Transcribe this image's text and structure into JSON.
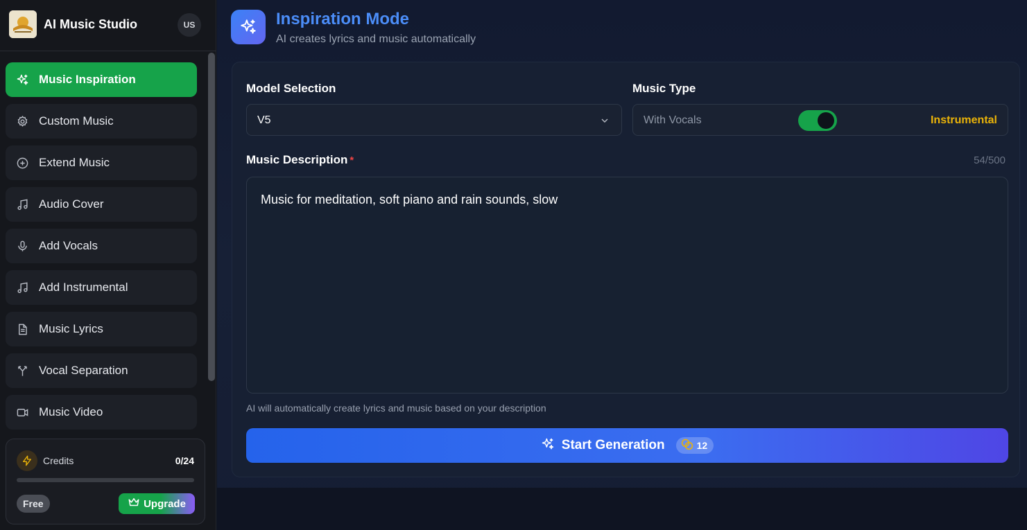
{
  "app": {
    "title": "AI Music Studio",
    "lang": "US"
  },
  "sidebar": {
    "items": [
      {
        "label": "Music Inspiration",
        "icon": "sparkles-icon",
        "active": true
      },
      {
        "label": "Custom Music",
        "icon": "gear-icon",
        "active": false
      },
      {
        "label": "Extend Music",
        "icon": "plus-circle-icon",
        "active": false
      },
      {
        "label": "Audio Cover",
        "icon": "music-note-icon",
        "active": false
      },
      {
        "label": "Add Vocals",
        "icon": "microphone-icon",
        "active": false
      },
      {
        "label": "Add Instrumental",
        "icon": "music-note-icon",
        "active": false
      },
      {
        "label": "Music Lyrics",
        "icon": "document-icon",
        "active": false
      },
      {
        "label": "Vocal Separation",
        "icon": "split-icon",
        "active": false
      },
      {
        "label": "Music Video",
        "icon": "video-icon",
        "active": false
      }
    ]
  },
  "credits": {
    "label": "Credits",
    "count": "0/24",
    "progress": 0,
    "plan": "Free",
    "upgrade_label": "Upgrade"
  },
  "main": {
    "title": "Inspiration Mode",
    "subtitle": "AI creates lyrics and music automatically",
    "model": {
      "label": "Model Selection",
      "value": "V5"
    },
    "music_type": {
      "label": "Music Type",
      "vocals_label": "With Vocals",
      "instrumental_label": "Instrumental",
      "instrumental_on": true
    },
    "description": {
      "label": "Music Description",
      "required_mark": "*",
      "count": "54/500",
      "value": "Music for meditation, soft piano and rain sounds, slow",
      "hint": "AI will automatically create lyrics and music based on your description"
    },
    "generate": {
      "label": "Start Generation",
      "cost": "12"
    }
  },
  "colors": {
    "accent_green": "#16a34a",
    "accent_blue": "#2563eb",
    "title_blue": "#4b8df8",
    "instrumental_yellow": "#eab308"
  }
}
